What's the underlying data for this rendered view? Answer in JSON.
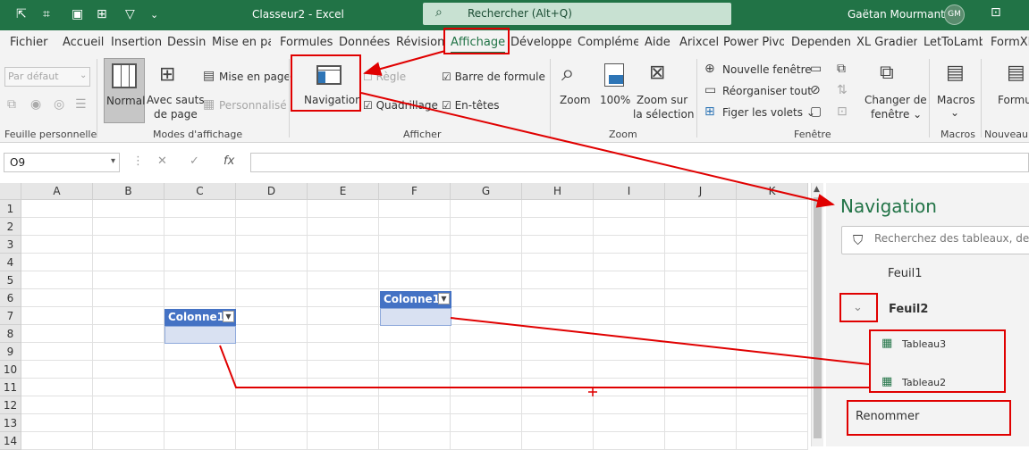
{
  "titlebar": {
    "title": "Classeur2  -  Excel",
    "search_text": "Rechercher (Alt+Q)",
    "user_name": "Gaëtan Mourmant",
    "user_initials": "GM",
    "bg_color": "#217346"
  },
  "menu": {
    "tabs": [
      "Fichier",
      "Accueil",
      "Insertion",
      "Dessin",
      "Mise en pa",
      "Formules",
      "Données",
      "Révision",
      "Affichage",
      "Développe",
      "Complémen",
      "Aide",
      "Arixcel",
      "Power Pivot",
      "Dependenc",
      "XL Gradient",
      "LetToLambd",
      "FormXL"
    ],
    "active": "Affichage"
  },
  "ribbon": {
    "view_select": "Par défaut",
    "normal": "Normal",
    "avec_sauts": "Avec sauts",
    "de_page": "de page",
    "mise_en_page": "Mise en page",
    "personnalise": "Personnalisé",
    "navigation": "Navigation",
    "regle": "Règle",
    "quadrillage": "Quadrillage",
    "barre_formule": "Barre de formule",
    "en_tetes": "En-têtes",
    "zoom": "Zoom",
    "zoom100": "100%",
    "zoom_sur": "Zoom sur",
    "la_selection": "la sélection",
    "nouvelle_fenetre": "Nouvelle fenêtre",
    "reorganiser": "Réorganiser tout",
    "figer": "Figer les volets",
    "changer": "Changer de",
    "fenetre_dd": "fenêtre",
    "macros": "Macros",
    "formu": "Formu",
    "groups": {
      "feuille": "Feuille personnelle",
      "modes": "Modes d'affichage",
      "afficher": "Afficher",
      "zoom": "Zoom",
      "fenetre": "Fenêtre",
      "macros": "Macros",
      "nouveau": "Nouveau"
    }
  },
  "formula": {
    "namebox": "O9",
    "fx": "fx",
    "value": ""
  },
  "sheet": {
    "columns": [
      "A",
      "B",
      "C",
      "D",
      "E",
      "F",
      "G",
      "H",
      "I",
      "J",
      "K"
    ],
    "rows": [
      "1",
      "2",
      "3",
      "4",
      "5",
      "6",
      "7",
      "8",
      "9",
      "10",
      "11",
      "12",
      "13",
      "14"
    ],
    "table_header": "Colonne1"
  },
  "pane": {
    "title": "Navigation",
    "search_placeholder": "Recherchez des tableaux, de",
    "sheet1": "Feuil1",
    "sheet2": "Feuil2",
    "table3": "Tableau3",
    "table2": "Tableau2",
    "rename": "Renommer"
  }
}
